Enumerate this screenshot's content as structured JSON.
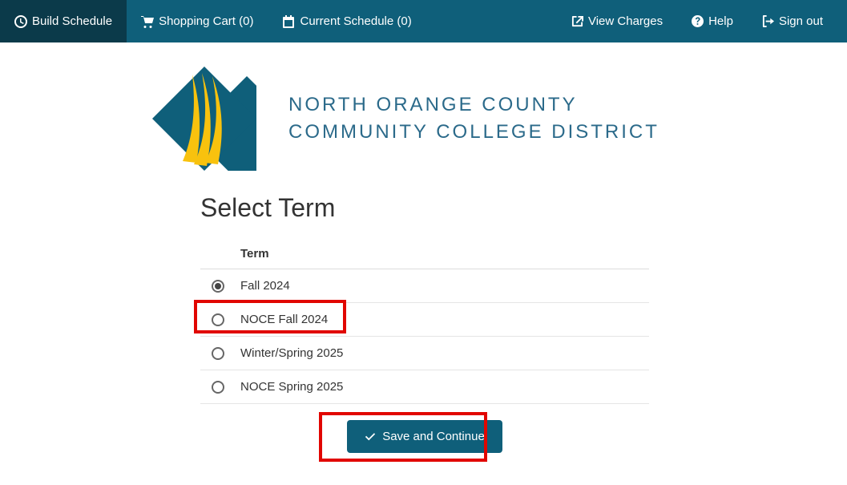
{
  "nav": {
    "build_schedule": "Build Schedule",
    "shopping_cart": "Shopping Cart (0)",
    "current_schedule": "Current Schedule (0)",
    "view_charges": "View Charges",
    "help": "Help",
    "sign_out": "Sign out"
  },
  "brand": {
    "line1": "NORTH ORANGE COUNTY",
    "line2": "COMMUNITY COLLEGE DISTRICT"
  },
  "page_title": "Select Term",
  "terms": {
    "header": "Term",
    "items": [
      {
        "label": "Fall 2024",
        "checked": true
      },
      {
        "label": "NOCE Fall 2024",
        "checked": false
      },
      {
        "label": "Winter/Spring 2025",
        "checked": false
      },
      {
        "label": "NOCE Spring 2025",
        "checked": false
      }
    ]
  },
  "save_btn": "Save and Continue"
}
